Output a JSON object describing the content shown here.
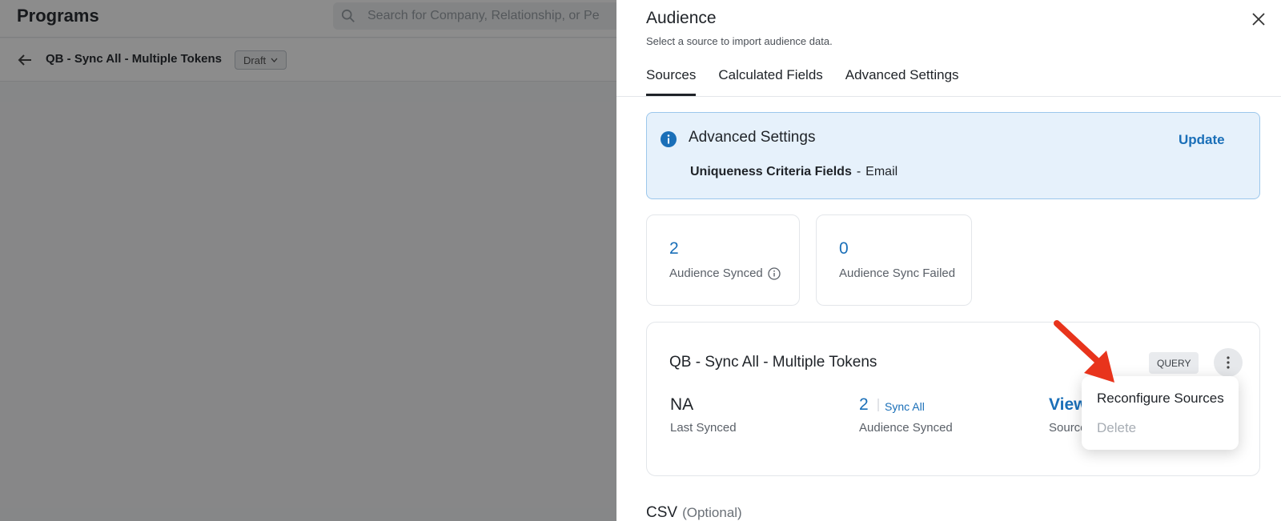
{
  "background": {
    "page_title": "Programs",
    "search_placeholder": "Search for Company, Relationship, or Pe",
    "program_name": "QB - Sync All - Multiple Tokens",
    "status_badge": "Draft"
  },
  "drawer": {
    "title": "Audience",
    "subtitle": "Select a source to import audience data.",
    "tabs": [
      {
        "label": "Sources",
        "active": true
      },
      {
        "label": "Calculated Fields",
        "active": false
      },
      {
        "label": "Advanced Settings",
        "active": false
      }
    ],
    "advanced": {
      "title": "Advanced Settings",
      "update_label": "Update",
      "criteria_label": "Uniqueness Criteria Fields",
      "criteria_separator": "-",
      "criteria_value": "Email"
    },
    "stats": [
      {
        "value": "2",
        "label": "Audience Synced",
        "has_info_icon": true
      },
      {
        "value": "0",
        "label": "Audience Sync Failed",
        "has_info_icon": false
      }
    ],
    "source": {
      "name": "QB - Sync All - Multiple Tokens",
      "type_badge": "QUERY",
      "last_synced_value": "NA",
      "last_synced_label": "Last Synced",
      "audience_synced_value": "2",
      "sync_all_label": "Sync All",
      "audience_synced_label": "Audience Synced",
      "view_label": "View",
      "source_label": "Source"
    },
    "menu": {
      "items": [
        {
          "label": "Reconfigure Sources",
          "disabled": false
        },
        {
          "label": "Delete",
          "disabled": true
        }
      ]
    },
    "csv": {
      "title": "CSV",
      "optional_label": "(Optional)"
    }
  },
  "colors": {
    "accent": "#1a6fb8",
    "info_bg": "#e6f1fb",
    "annotation_arrow": "#e8341c"
  }
}
